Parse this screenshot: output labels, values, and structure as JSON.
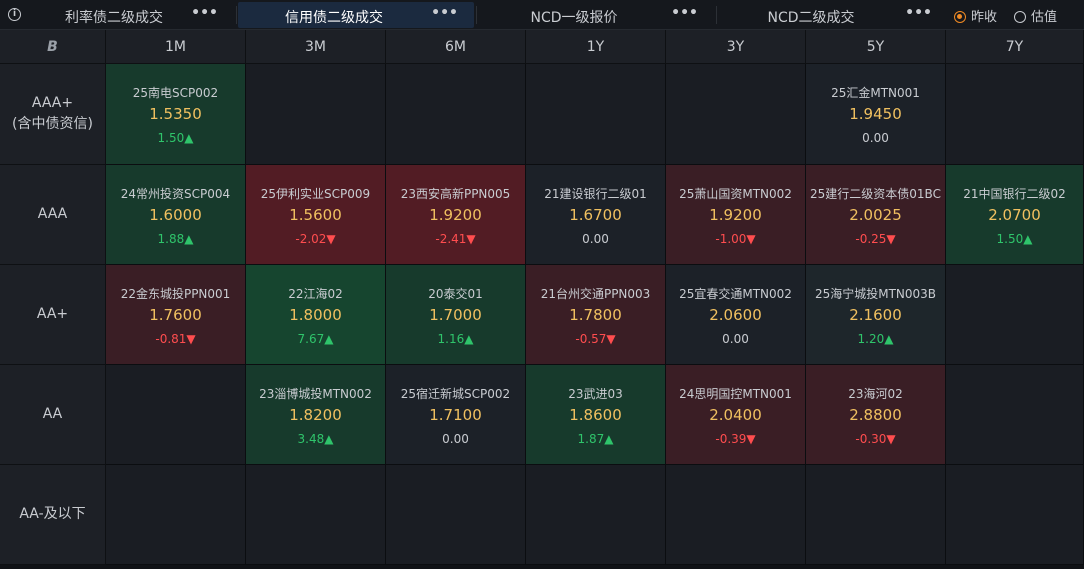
{
  "tabs": [
    {
      "label": "利率债二级成交",
      "more": "•••",
      "active": false
    },
    {
      "label": "信用债二级成交",
      "more": "•••",
      "active": true
    },
    {
      "label": "NCD一级报价",
      "more": "•••",
      "active": false
    },
    {
      "label": "NCD二级成交",
      "more": "•••",
      "active": false
    }
  ],
  "info_icon": "ⓘ",
  "radios": [
    {
      "label": "昨收",
      "checked": true
    },
    {
      "label": "估值",
      "checked": false
    }
  ],
  "corner_icon": "B",
  "columns": [
    "1M",
    "3M",
    "6M",
    "1Y",
    "3Y",
    "5Y",
    "7Y"
  ],
  "rows": [
    {
      "label": "AAA+\n(含中债资信)",
      "cells": [
        {
          "bond": "25南电SCP002",
          "yield": "1.5350",
          "change": "1.50▲",
          "dir": "up",
          "shade": "g1"
        },
        null,
        null,
        null,
        null,
        {
          "bond": "25汇金MTN001",
          "yield": "1.9450",
          "change": "0.00",
          "dir": "flat",
          "shade": "flat"
        },
        null
      ]
    },
    {
      "label": "AAA",
      "cells": [
        {
          "bond": "24常州投资SCP004",
          "yield": "1.6000",
          "change": "1.88▲",
          "dir": "up",
          "shade": "g1"
        },
        {
          "bond": "25伊利实业SCP009",
          "yield": "1.5600",
          "change": "-2.02▼",
          "dir": "down",
          "shade": "r2"
        },
        {
          "bond": "23西安高新PPN005",
          "yield": "1.9200",
          "change": "-2.41▼",
          "dir": "down",
          "shade": "r2"
        },
        {
          "bond": "21建设银行二级01",
          "yield": "1.6700",
          "change": "0.00",
          "dir": "flat",
          "shade": "flat"
        },
        {
          "bond": "25萧山国资MTN002",
          "yield": "1.9200",
          "change": "-1.00▼",
          "dir": "down",
          "shade": "r1"
        },
        {
          "bond": "25建行二级资本债01BC",
          "yield": "2.0025",
          "change": "-0.25▼",
          "dir": "down",
          "shade": "r1"
        },
        {
          "bond": "21中国银行二级02",
          "yield": "2.0700",
          "change": "1.50▲",
          "dir": "up",
          "shade": "g1"
        }
      ]
    },
    {
      "label": "AA+",
      "cells": [
        {
          "bond": "22金东城投PPN001",
          "yield": "1.7600",
          "change": "-0.81▼",
          "dir": "down",
          "shade": "r1"
        },
        {
          "bond": "22江海02",
          "yield": "1.8000",
          "change": "7.67▲",
          "dir": "up",
          "shade": "g2"
        },
        {
          "bond": "20泰交01",
          "yield": "1.7000",
          "change": "1.16▲",
          "dir": "up",
          "shade": "g1"
        },
        {
          "bond": "21台州交通PPN003",
          "yield": "1.7800",
          "change": "-0.57▼",
          "dir": "down",
          "shade": "r1"
        },
        {
          "bond": "25宜春交通MTN002",
          "yield": "2.0600",
          "change": "0.00",
          "dir": "flat",
          "shade": "flat"
        },
        {
          "bond": "25海宁城投MTN003B",
          "yield": "2.1600",
          "change": "1.20▲",
          "dir": "up",
          "shade": "n"
        },
        null
      ]
    },
    {
      "label": "AA",
      "cells": [
        null,
        {
          "bond": "23淄博城投MTN002",
          "yield": "1.8200",
          "change": "3.48▲",
          "dir": "up",
          "shade": "g1"
        },
        {
          "bond": "25宿迁新城SCP002",
          "yield": "1.7100",
          "change": "0.00",
          "dir": "flat",
          "shade": "flat"
        },
        {
          "bond": "23武进03",
          "yield": "1.8600",
          "change": "1.87▲",
          "dir": "up",
          "shade": "g1"
        },
        {
          "bond": "24思明国控MTN001",
          "yield": "2.0400",
          "change": "-0.39▼",
          "dir": "down",
          "shade": "r1"
        },
        {
          "bond": "23海河02",
          "yield": "2.8800",
          "change": "-0.30▼",
          "dir": "down",
          "shade": "r1"
        },
        null
      ]
    },
    {
      "label": "AA-及以下",
      "cells": [
        null,
        null,
        null,
        null,
        null,
        null,
        null
      ]
    }
  ]
}
